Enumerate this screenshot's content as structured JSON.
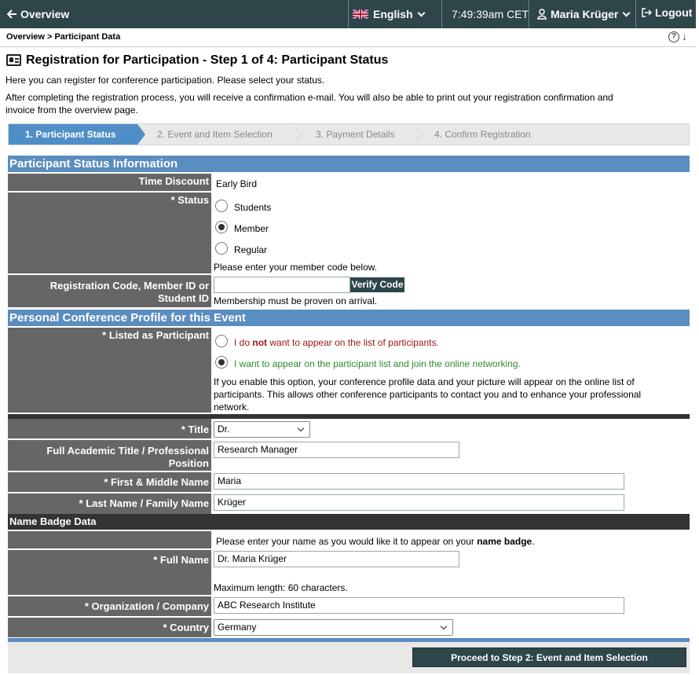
{
  "topbar": {
    "overview": "Overview",
    "language": "English",
    "time": "7:49:39am",
    "timezone": "CET",
    "user": "Maria Krüger",
    "logout": "Logout"
  },
  "breadcrumb": "Overview > Participant Data",
  "page": {
    "title": "Registration for Participation - Step 1 of 4: Participant Status",
    "intro1": "Here you can register for conference participation. Please select your status.",
    "intro2a": "After completing the registration process, you will receive a confirmation e-mail. You will also be able to print out your registration confirmation and",
    "intro2b": "invoice from the overview page."
  },
  "steps": [
    {
      "label": "1. Participant Status",
      "active": true
    },
    {
      "label": "2. Event and Item Selection",
      "active": false
    },
    {
      "label": "3. Payment Details",
      "active": false
    },
    {
      "label": "4. Confirm Registration",
      "active": false
    }
  ],
  "status_section": {
    "heading": "Participant Status Information",
    "time_discount_label": "Time Discount",
    "time_discount_value": "Early Bird",
    "status_label": "* Status",
    "status_options": [
      "Students",
      "Member",
      "Regular"
    ],
    "status_selected": "Member",
    "status_hint": "Please enter your member code below.",
    "code_label_1": "Registration Code, Member ID or",
    "code_label_2": "Student ID",
    "code_value": "",
    "verify_button": "Verify Code",
    "code_hint": "Membership must be proven on arrival."
  },
  "profile_section": {
    "heading": "Personal Conference Profile for this Event",
    "listed_label": "* Listed as Participant",
    "opt_no_pre": "I do ",
    "opt_no_bold": "not",
    "opt_no_post": " want to appear on the list of participants.",
    "opt_yes": "I want to appear on the participant list and join the online networking.",
    "listed_selected": "yes",
    "explain1": "If you enable this option, your conference profile data and your picture will appear on the online list of",
    "explain2": "participants. This allows other conference participants to contact you and to enhance your professional",
    "explain3": "network."
  },
  "personal": {
    "title_label": "* Title",
    "title_value": "Dr.",
    "position_label_1": "Full Academic Title / Professional",
    "position_label_2": "Position",
    "position_value": "Research Manager",
    "first_label": "* First & Middle Name",
    "first_value": "Maria",
    "last_label": "* Last Name / Family Name",
    "last_value": "Krüger"
  },
  "badge": {
    "heading": "Name Badge Data",
    "hint_pre": "Please enter your name as you would like it to appear on your ",
    "hint_bold": "name badge",
    "hint_post": ".",
    "fullname_label": "* Full Name",
    "fullname_value": "Dr. Maria Krüger",
    "fullname_hint": "Maximum length: 60 characters.",
    "org_label": "* Organization / Company",
    "org_value": "ABC Research Institute",
    "country_label": "* Country",
    "country_value": "Germany"
  },
  "proceed_button": "Proceed to Step 2: Event and Item Selection",
  "colors": {
    "topbar": "#2e4649",
    "section": "#5a8dc0",
    "label_bg": "#666666",
    "step_active": "#4f8ec6",
    "red_text": "#a31515",
    "green_text": "#2e8b2e"
  }
}
